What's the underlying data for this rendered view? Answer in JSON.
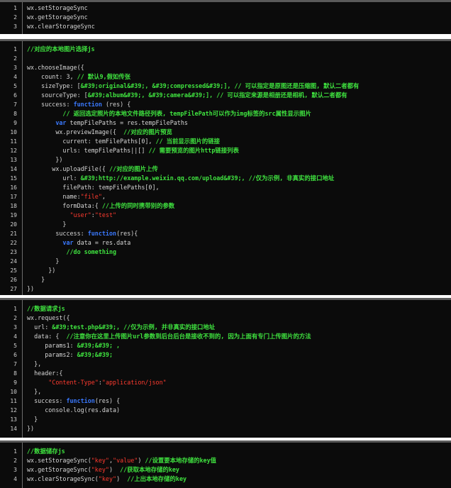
{
  "blocks": [
    {
      "lines": [
        {
          "num": "1",
          "segs": [
            {
              "t": "wx.setStorageSync",
              "c": "n"
            }
          ]
        },
        {
          "num": "2",
          "segs": [
            {
              "t": "wx.getStorageSync",
              "c": "n"
            }
          ]
        },
        {
          "num": "3",
          "segs": [
            {
              "t": "wx.clearStorageSync",
              "c": "n"
            }
          ]
        }
      ]
    },
    {
      "lines": [
        {
          "num": "1",
          "segs": [
            {
              "t": "//对应的本地图片选择js",
              "c": "c"
            }
          ]
        },
        {
          "num": "2",
          "segs": []
        },
        {
          "num": "3",
          "segs": [
            {
              "t": "wx.chooseImage({",
              "c": "n"
            }
          ]
        },
        {
          "num": "4",
          "segs": [
            {
              "t": "    count: 3, ",
              "c": "n"
            },
            {
              "t": "// 默认9,假如传张",
              "c": "c"
            }
          ]
        },
        {
          "num": "5",
          "segs": [
            {
              "t": "    sizeType: [",
              "c": "n"
            },
            {
              "t": "&#39;original&#39;, &#39;compressed&#39;], // 可以指定是原图还是压缩图, 默认二者都有",
              "c": "c"
            }
          ]
        },
        {
          "num": "6",
          "segs": [
            {
              "t": "    sourceType: [",
              "c": "n"
            },
            {
              "t": "&#39;album&#39;, &#39;camera&#39;], // 可以指定来源是相册还是相机, 默认二者都有",
              "c": "c"
            }
          ]
        },
        {
          "num": "7",
          "segs": [
            {
              "t": "    success: ",
              "c": "n"
            },
            {
              "t": "function",
              "c": "k"
            },
            {
              "t": " (res) {",
              "c": "n"
            }
          ]
        },
        {
          "num": "8",
          "segs": [
            {
              "t": "          ",
              "c": "n"
            },
            {
              "t": "// 返回选定照片的本地文件路径列表, tempFilePath可以作为img标签的src属性显示图片",
              "c": "c"
            }
          ]
        },
        {
          "num": "9",
          "segs": [
            {
              "t": "        ",
              "c": "n"
            },
            {
              "t": "var",
              "c": "k"
            },
            {
              "t": " tempFilePaths = res.tempFilePaths",
              "c": "n"
            }
          ]
        },
        {
          "num": "10",
          "segs": [
            {
              "t": "        wx.previewImage({  ",
              "c": "n"
            },
            {
              "t": "//对应的图片预览",
              "c": "c"
            }
          ]
        },
        {
          "num": "11",
          "segs": [
            {
              "t": "          current: temFilePaths[0], ",
              "c": "n"
            },
            {
              "t": "// 当前显示图片的链接",
              "c": "c"
            }
          ]
        },
        {
          "num": "12",
          "segs": [
            {
              "t": "          urls: tempFilePaths||[] ",
              "c": "n"
            },
            {
              "t": "// 需要预览的图片http链接列表",
              "c": "c"
            }
          ]
        },
        {
          "num": "13",
          "segs": [
            {
              "t": "        })",
              "c": "n"
            }
          ]
        },
        {
          "num": "14",
          "segs": [
            {
              "t": "       wx.uploadFile({ ",
              "c": "n"
            },
            {
              "t": "//对应的图片上传",
              "c": "c"
            }
          ]
        },
        {
          "num": "15",
          "segs": [
            {
              "t": "          url: ",
              "c": "n"
            },
            {
              "t": "&#39;http://example.weixin.qq.com/upload&#39;, //仅为示例, 非真实的接口地址",
              "c": "c"
            }
          ]
        },
        {
          "num": "16",
          "segs": [
            {
              "t": "          filePath: tempFilePaths[0],",
              "c": "n"
            }
          ]
        },
        {
          "num": "17",
          "segs": [
            {
              "t": "          name:",
              "c": "n"
            },
            {
              "t": "\"file\"",
              "c": "s"
            },
            {
              "t": ",",
              "c": "n"
            }
          ]
        },
        {
          "num": "18",
          "segs": [
            {
              "t": "          formData:{ ",
              "c": "n"
            },
            {
              "t": "//上传的同时携带别的参数",
              "c": "c"
            }
          ]
        },
        {
          "num": "19",
          "segs": [
            {
              "t": "            ",
              "c": "n"
            },
            {
              "t": "\"user\"",
              "c": "s"
            },
            {
              "t": ":",
              "c": "n"
            },
            {
              "t": "\"test\"",
              "c": "s"
            }
          ]
        },
        {
          "num": "20",
          "segs": [
            {
              "t": "          }",
              "c": "n"
            }
          ]
        },
        {
          "num": "21",
          "segs": [
            {
              "t": "        success: ",
              "c": "n"
            },
            {
              "t": "function",
              "c": "k"
            },
            {
              "t": "(res){",
              "c": "n"
            }
          ]
        },
        {
          "num": "22",
          "segs": [
            {
              "t": "          ",
              "c": "n"
            },
            {
              "t": "var",
              "c": "k"
            },
            {
              "t": " data = res.data",
              "c": "n"
            }
          ]
        },
        {
          "num": "23",
          "segs": [
            {
              "t": "           ",
              "c": "n"
            },
            {
              "t": "//do something",
              "c": "c"
            }
          ]
        },
        {
          "num": "24",
          "segs": [
            {
              "t": "        }",
              "c": "n"
            }
          ]
        },
        {
          "num": "25",
          "segs": [
            {
              "t": "      })",
              "c": "n"
            }
          ]
        },
        {
          "num": "26",
          "segs": [
            {
              "t": "    }",
              "c": "n"
            }
          ]
        },
        {
          "num": "27",
          "segs": [
            {
              "t": "})",
              "c": "n"
            }
          ]
        }
      ]
    },
    {
      "lines": [
        {
          "num": "1",
          "segs": [
            {
              "t": "//数据请求js",
              "c": "c"
            }
          ]
        },
        {
          "num": "2",
          "segs": [
            {
              "t": "wx.request({",
              "c": "n"
            }
          ]
        },
        {
          "num": "3",
          "segs": [
            {
              "t": "  url: ",
              "c": "n"
            },
            {
              "t": "&#39;test.php&#39;, //仅为示例, 并非真实的接口地址",
              "c": "c"
            }
          ]
        },
        {
          "num": "4",
          "segs": [
            {
              "t": "  data: {  ",
              "c": "n"
            },
            {
              "t": "//注意你在这里上传图片url参数到后台后台是接收不到的, 因为上面有专门上传图片的方法",
              "c": "c"
            }
          ]
        },
        {
          "num": "5",
          "segs": [
            {
              "t": "     params1: ",
              "c": "n"
            },
            {
              "t": "&#39;&#39; ,",
              "c": "c"
            }
          ]
        },
        {
          "num": "6",
          "segs": [
            {
              "t": "     params2: ",
              "c": "n"
            },
            {
              "t": "&#39;&#39;",
              "c": "c"
            }
          ]
        },
        {
          "num": "7",
          "segs": [
            {
              "t": "  },",
              "c": "n"
            }
          ]
        },
        {
          "num": "8",
          "segs": [
            {
              "t": "  header:{",
              "c": "n"
            }
          ]
        },
        {
          "num": "9",
          "segs": [
            {
              "t": "      ",
              "c": "n"
            },
            {
              "t": "\"Content-Type\"",
              "c": "s"
            },
            {
              "t": ":",
              "c": "n"
            },
            {
              "t": "\"application/json\"",
              "c": "s"
            }
          ]
        },
        {
          "num": "10",
          "segs": [
            {
              "t": "  },",
              "c": "n"
            }
          ]
        },
        {
          "num": "11",
          "segs": [
            {
              "t": "  success: ",
              "c": "n"
            },
            {
              "t": "function",
              "c": "k"
            },
            {
              "t": "(res) {",
              "c": "n"
            }
          ]
        },
        {
          "num": "12",
          "segs": [
            {
              "t": "     console.log(res.data)",
              "c": "n"
            }
          ]
        },
        {
          "num": "13",
          "segs": [
            {
              "t": "  }",
              "c": "n"
            }
          ]
        },
        {
          "num": "14",
          "segs": [
            {
              "t": "})",
              "c": "n"
            }
          ]
        }
      ]
    },
    {
      "lines": [
        {
          "num": "1",
          "segs": [
            {
              "t": "//数据储存js",
              "c": "c"
            }
          ]
        },
        {
          "num": "2",
          "segs": [
            {
              "t": "wx.setStorageSync(",
              "c": "n"
            },
            {
              "t": "\"key\"",
              "c": "s"
            },
            {
              "t": ",",
              "c": "n"
            },
            {
              "t": "\"value\"",
              "c": "s"
            },
            {
              "t": ") ",
              "c": "n"
            },
            {
              "t": "//设置要本地存储的key值",
              "c": "c"
            }
          ]
        },
        {
          "num": "3",
          "segs": [
            {
              "t": "wx.getStorageSync(",
              "c": "n"
            },
            {
              "t": "\"key\"",
              "c": "s"
            },
            {
              "t": ")  ",
              "c": "n"
            },
            {
              "t": "//获取本地存储的key",
              "c": "c"
            }
          ]
        },
        {
          "num": "4",
          "segs": [
            {
              "t": "wx.clearStorageSync(",
              "c": "n"
            },
            {
              "t": "\"key\"",
              "c": "s"
            },
            {
              "t": ")  ",
              "c": "n"
            },
            {
              "t": "//上出本地存储的key",
              "c": "c"
            }
          ]
        }
      ]
    }
  ]
}
